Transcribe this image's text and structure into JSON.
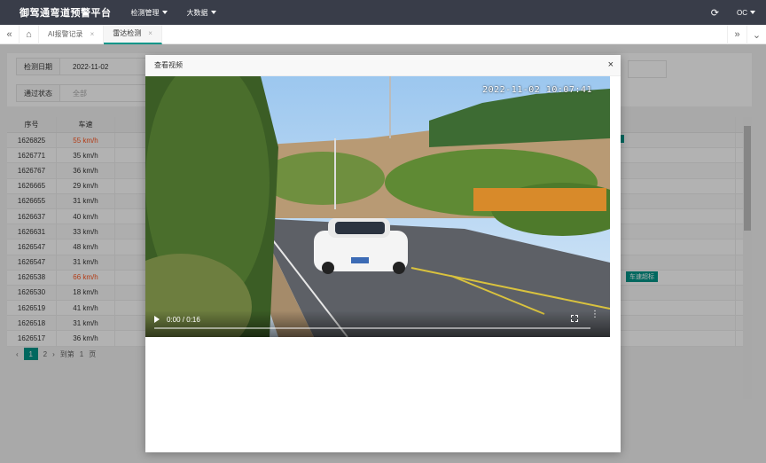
{
  "app": {
    "title": "御驾通弯道预警平台"
  },
  "nav": {
    "items": [
      {
        "label": "检测管理"
      },
      {
        "label": "大数据"
      }
    ],
    "user": "OC"
  },
  "tabs": [
    {
      "label": "AI报警记录"
    },
    {
      "label": "雷达检测"
    }
  ],
  "filters": {
    "date_label": "检测日期",
    "date_value": "2022-11-02",
    "status_label": "通过状态",
    "status_value": "全部"
  },
  "table": {
    "headers": [
      "序号",
      "车速"
    ],
    "rows": [
      {
        "id": "1626825",
        "speed": "55 km/h",
        "alert": true
      },
      {
        "id": "1626771",
        "speed": "35 km/h",
        "alert": false
      },
      {
        "id": "1626767",
        "speed": "36 km/h",
        "alert": false
      },
      {
        "id": "1626665",
        "speed": "29 km/h",
        "alert": false
      },
      {
        "id": "1626655",
        "speed": "31 km/h",
        "alert": false
      },
      {
        "id": "1626637",
        "speed": "40 km/h",
        "alert": false
      },
      {
        "id": "1626631",
        "speed": "33 km/h",
        "alert": false
      },
      {
        "id": "1626547",
        "speed": "48 km/h",
        "alert": false
      },
      {
        "id": "1626547",
        "speed": "31 km/h",
        "alert": false
      },
      {
        "id": "1626538",
        "speed": "66 km/h",
        "alert": true
      },
      {
        "id": "1626530",
        "speed": "18 km/h",
        "alert": false
      },
      {
        "id": "1626519",
        "speed": "41 km/h",
        "alert": false
      },
      {
        "id": "1626518",
        "speed": "31 km/h",
        "alert": false
      },
      {
        "id": "1626517",
        "speed": "36 km/h",
        "alert": false
      }
    ],
    "badge_label": "车速超标"
  },
  "pager": {
    "current": "1",
    "next": "2",
    "goto": "到第",
    "page": "1",
    "unit": "页"
  },
  "modal": {
    "title": "查看视频",
    "overlay_time": "2022-11-02 10:07:41",
    "player_time": "0:00 / 0:16",
    "progress": 0
  }
}
